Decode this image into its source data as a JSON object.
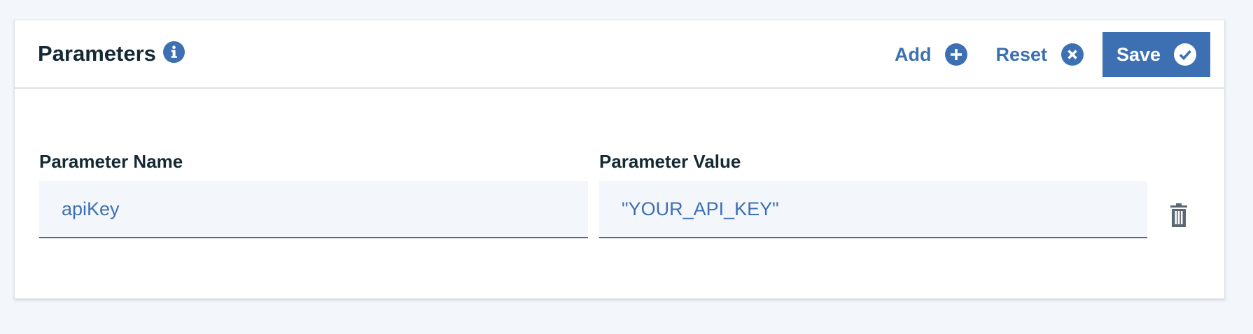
{
  "header": {
    "title": "Parameters",
    "info_icon": "info-icon"
  },
  "actions": {
    "add_label": "Add",
    "add_icon": "plus-circle-icon",
    "reset_label": "Reset",
    "reset_icon": "close-circle-icon",
    "save_label": "Save",
    "save_icon": "checkmark-circle-icon"
  },
  "parameters": [
    {
      "name_label": "Parameter Name",
      "name_value": "apiKey",
      "value_label": "Parameter Value",
      "value_value": "\"YOUR_API_KEY\"",
      "delete_icon": "trash-icon"
    }
  ],
  "colors": {
    "accent": "#3d70b2",
    "text_dark": "#152935",
    "input_bg": "#f3f6fa",
    "page_bg": "#f3f6fa",
    "icon_gray": "#5a6872"
  }
}
